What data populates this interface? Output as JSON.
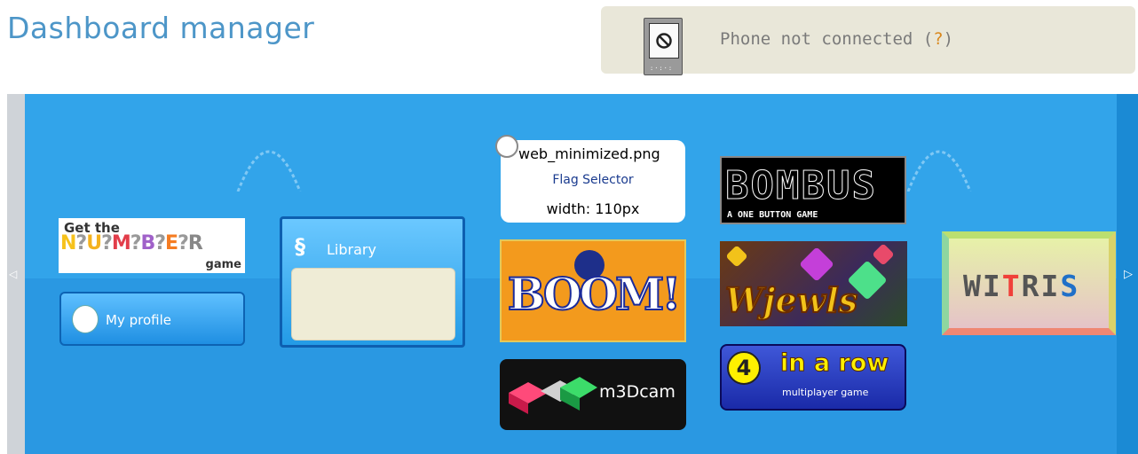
{
  "header": {
    "title": "Dashboard manager"
  },
  "phone_status": {
    "text": "Phone not connected (",
    "help": "?",
    "close": ")",
    "icon": "phone-disconnected-icon"
  },
  "tiles": {
    "numbers": {
      "get_the": "Get the",
      "letters": [
        "N",
        "?",
        "U",
        "?",
        "M",
        "?",
        "B",
        "?",
        "E",
        "?",
        "R"
      ],
      "game": "game"
    },
    "profile": {
      "label": "My profile",
      "icon": "baby-face-icon"
    },
    "library": {
      "label": "Library",
      "icon": "s-logo-icon"
    },
    "tooltip": {
      "filename": "web_minimized.png",
      "name": "Flag Selector",
      "width": "width: 110px"
    },
    "boom": {
      "label": "BOOM!"
    },
    "m3dcam": {
      "label": "m3Dcam"
    },
    "bombus": {
      "title": "BOMBUS",
      "subtitle": "A ONE BUTTON GAME"
    },
    "jewels": {
      "label": "Wjewls"
    },
    "fourrow": {
      "number": "4",
      "main": "in a row",
      "sub": "multiplayer game"
    },
    "witris": {
      "prefix": "WI",
      "r": "T",
      "mid": "RI",
      "s": "S"
    }
  },
  "nav": {
    "left": "◁",
    "right": "▷"
  },
  "colors": {
    "stage": "#32a4ea",
    "title": "#4d96c8",
    "phone_box": "#e9e7d9"
  }
}
